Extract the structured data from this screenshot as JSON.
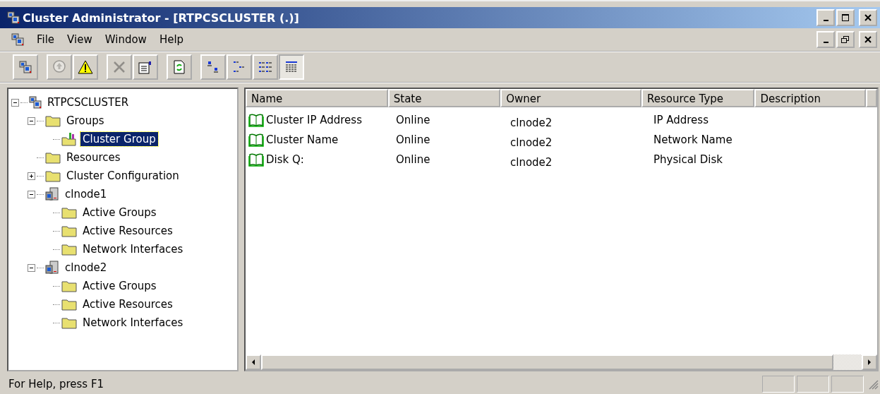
{
  "window": {
    "title": "Cluster Administrator - [RTPCSCLUSTER (.)]"
  },
  "menu": [
    "File",
    "View",
    "Window",
    "Help"
  ],
  "toolbar": [
    {
      "kind": "open-connection",
      "disabled": false,
      "selected": false
    },
    {
      "kind": "bring-online",
      "disabled": true,
      "selected": false
    },
    {
      "kind": "take-offline",
      "disabled": false,
      "selected": false
    },
    {
      "kind": "delete",
      "disabled": true,
      "selected": false
    },
    {
      "kind": "properties",
      "disabled": false,
      "selected": false
    },
    {
      "kind": "refresh",
      "disabled": false,
      "selected": false
    },
    {
      "kind": "large-icons",
      "disabled": false,
      "selected": false
    },
    {
      "kind": "small-icons",
      "disabled": false,
      "selected": false
    },
    {
      "kind": "list",
      "disabled": false,
      "selected": false
    },
    {
      "kind": "details",
      "disabled": false,
      "selected": true
    }
  ],
  "tree": [
    {
      "label": "RTPCSCLUSTER",
      "kind": "cluster",
      "expanded": true,
      "selected": false,
      "children": [
        {
          "label": "Groups",
          "kind": "folder",
          "expanded": true,
          "selected": false,
          "children": [
            {
              "label": "Cluster Group",
              "kind": "group",
              "selected": true
            }
          ]
        },
        {
          "label": "Resources",
          "kind": "folder",
          "selected": false
        },
        {
          "label": "Cluster Configuration",
          "kind": "folder",
          "expanded": false,
          "selected": false
        },
        {
          "label": "clnode1",
          "kind": "node",
          "expanded": true,
          "selected": false,
          "children": [
            {
              "label": "Active Groups",
              "kind": "folder",
              "selected": false
            },
            {
              "label": "Active Resources",
              "kind": "folder",
              "selected": false
            },
            {
              "label": "Network Interfaces",
              "kind": "folder",
              "selected": false
            }
          ]
        },
        {
          "label": "clnode2",
          "kind": "node",
          "expanded": true,
          "selected": false,
          "children": [
            {
              "label": "Active Groups",
              "kind": "folder",
              "selected": false
            },
            {
              "label": "Active Resources",
              "kind": "folder",
              "selected": false
            },
            {
              "label": "Network Interfaces",
              "kind": "folder",
              "selected": false
            }
          ]
        }
      ]
    }
  ],
  "table": {
    "columns": [
      "Name",
      "State",
      "Owner",
      "Resource Type",
      "Description"
    ],
    "rows": [
      [
        "Cluster IP Address",
        "Online",
        "clnode2",
        "IP Address",
        ""
      ],
      [
        "Cluster Name",
        "Online",
        "clnode2",
        "Network Name",
        ""
      ],
      [
        "Disk Q:",
        "Online",
        "clnode2",
        "Physical Disk",
        ""
      ]
    ]
  },
  "status_bar": "For Help, press F1"
}
